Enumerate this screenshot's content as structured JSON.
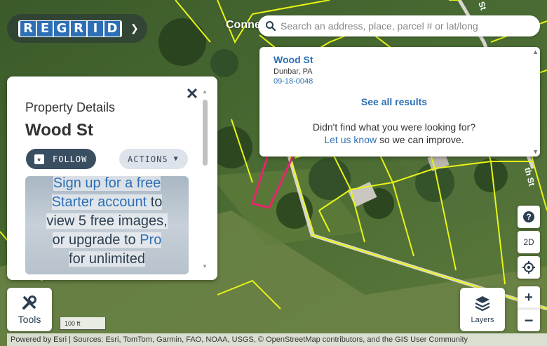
{
  "app": {
    "logo_letters": [
      "R",
      "E",
      "G",
      "R",
      "I",
      "D"
    ],
    "brand_color": "#2c6fb6",
    "connect_text": "Conne"
  },
  "search": {
    "placeholder": "Search an address, place, parcel # or lat/long",
    "icon": "search-icon"
  },
  "results": {
    "item": {
      "title": "Wood St",
      "location": "Dunbar, PA",
      "parcel_id": "09-18-0048"
    },
    "see_all": "See all results",
    "not_found": "Didn't find what you were looking for?",
    "link_text": "Let us know",
    "improve_text": " so we can improve."
  },
  "panel": {
    "label": "Property Details",
    "title": "Wood St",
    "follow_label": "FOLLOW",
    "actions_label": "ACTIONS",
    "promo": {
      "link1": "Sign up for a free",
      "link2": "Starter account",
      "text1": " to",
      "text2": "view 5 free images,",
      "text3": "or upgrade to ",
      "link3": "Pro",
      "text4": "for unlimited"
    }
  },
  "map": {
    "street_label_right": "th St",
    "street_label_top": "St",
    "parcel_outline_color": "#e8f516",
    "selected_parcel_color": "#e6246e",
    "scale_label": "100 ft"
  },
  "controls": {
    "tools_label": "Tools",
    "layers_label": "Layers",
    "help_label": "?",
    "view_mode_label": "2D",
    "zoom_in_label": "+",
    "zoom_out_label": "−"
  },
  "attribution": "Powered by Esri | Sources: Esri, TomTom, Garmin, FAO, NOAA, USGS, © OpenStreetMap contributors, and the GIS User Community"
}
